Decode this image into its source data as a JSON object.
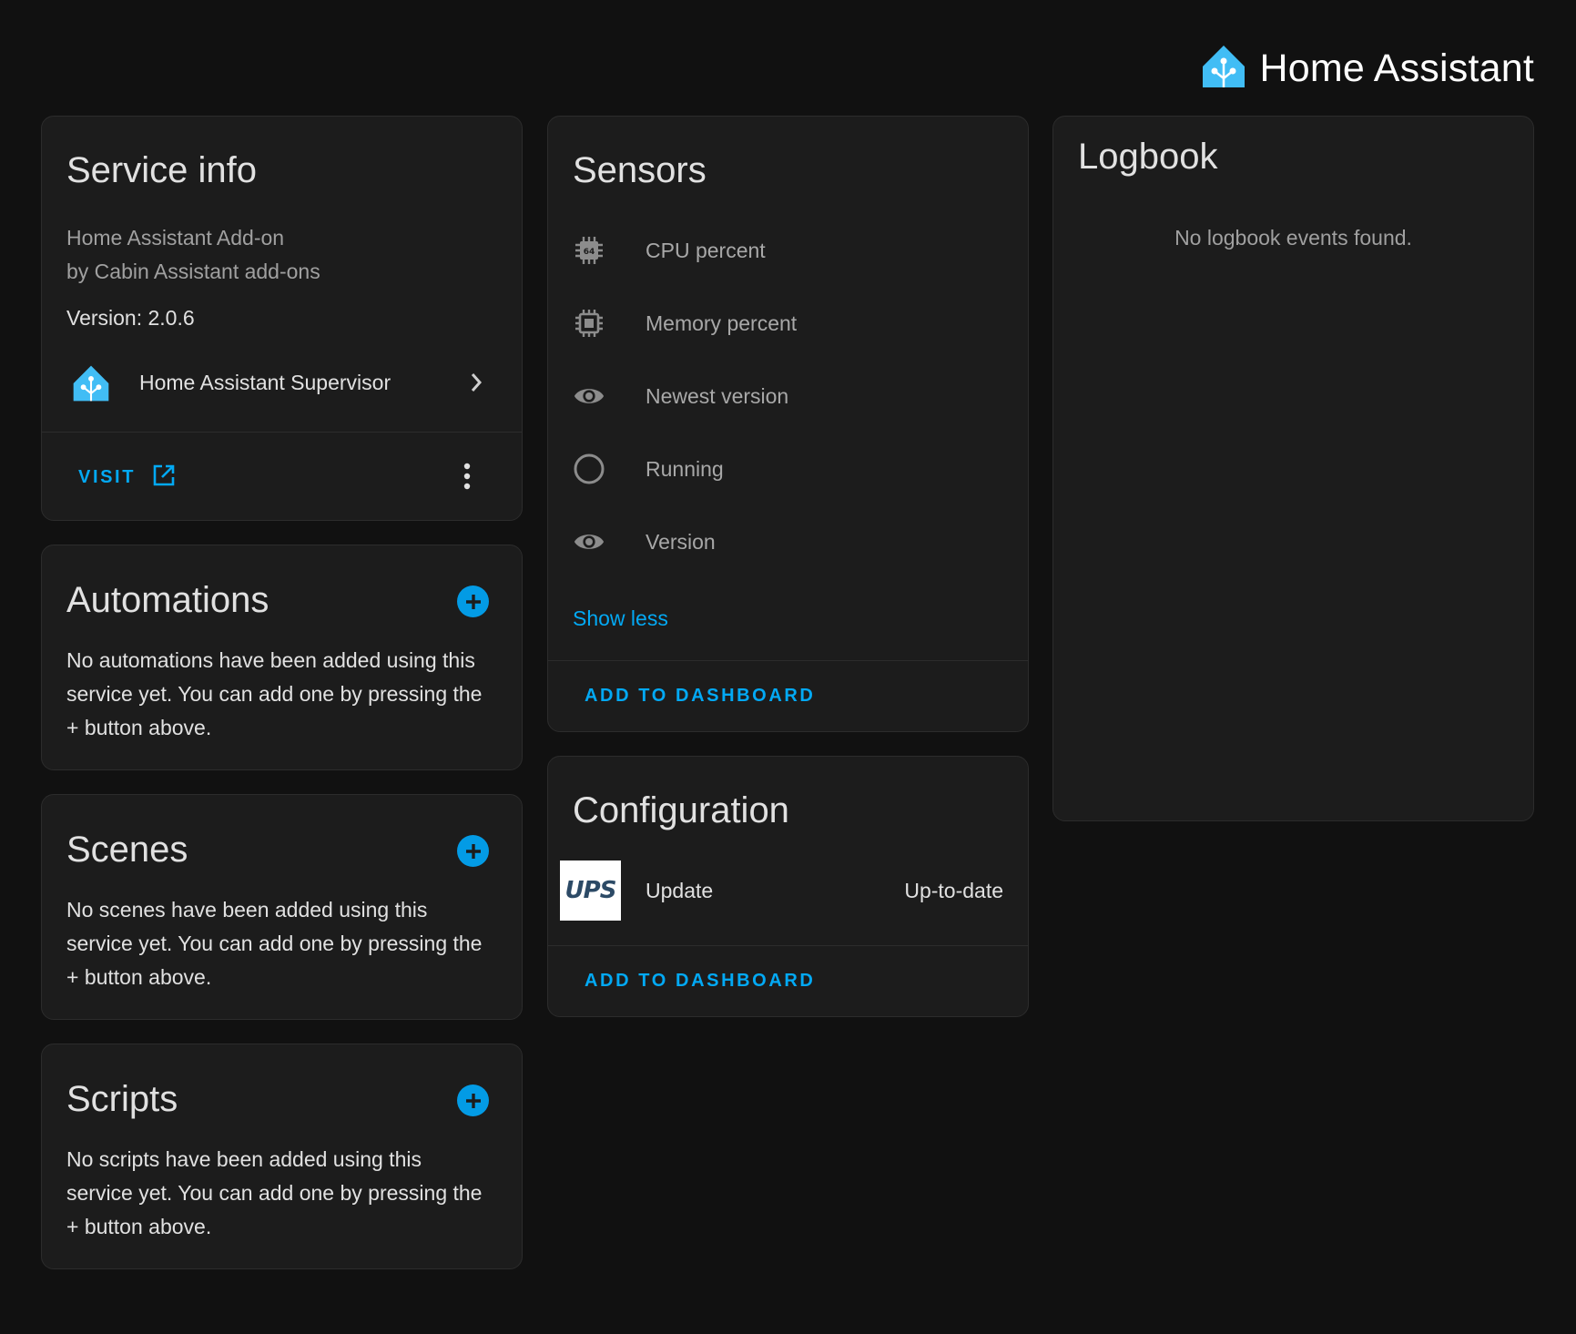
{
  "header": {
    "brand_name": "Home Assistant"
  },
  "service_info": {
    "title": "Service info",
    "subtitle_line1": "Home Assistant Add-on",
    "subtitle_line2": "by Cabin Assistant add-ons",
    "version": "Version: 2.0.6",
    "supervisor_label": "Home Assistant Supervisor",
    "visit_label": "VISIT"
  },
  "automations": {
    "title": "Automations",
    "empty_text": "No automations have been added using this service yet. You can add one by pressing the + button above."
  },
  "scenes": {
    "title": "Scenes",
    "empty_text": "No scenes have been added using this service yet. You can add one by pressing the + button above."
  },
  "scripts": {
    "title": "Scripts",
    "empty_text": "No scripts have been added using this service yet. You can add one by pressing the + button above."
  },
  "sensors": {
    "title": "Sensors",
    "items": [
      {
        "label": "CPU percent",
        "icon": "cpu-64-bit-icon"
      },
      {
        "label": "Memory percent",
        "icon": "chip-icon"
      },
      {
        "label": "Newest version",
        "icon": "eye-icon"
      },
      {
        "label": "Running",
        "icon": "circle-outline-icon"
      },
      {
        "label": "Version",
        "icon": "eye-icon"
      }
    ],
    "show_less": "Show less",
    "add_to_dashboard": "ADD TO DASHBOARD"
  },
  "configuration": {
    "title": "Configuration",
    "update_label": "Update",
    "update_state": "Up-to-date",
    "logo_text": "UPS",
    "add_to_dashboard": "ADD TO DASHBOARD"
  },
  "logbook": {
    "title": "Logbook",
    "empty_text": "No logbook events found."
  },
  "colors": {
    "background": "#111111",
    "card": "#1c1c1c",
    "accent": "#03a9f4",
    "ha_blue": "#41bdf5"
  }
}
